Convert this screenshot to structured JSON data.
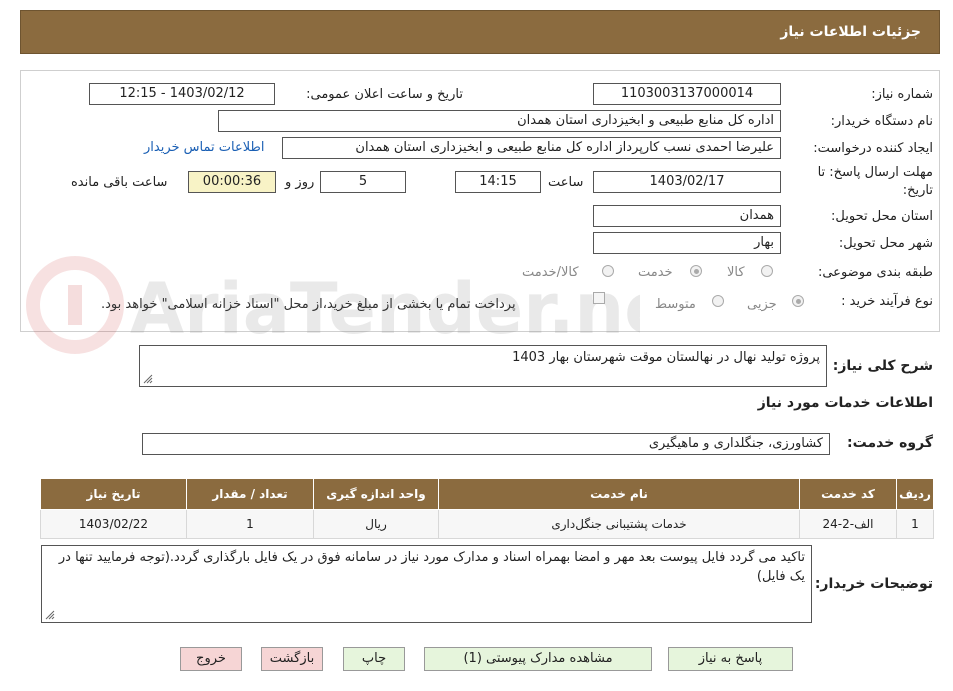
{
  "header": {
    "title": "جزئیات اطلاعات نیاز"
  },
  "form": {
    "need_number_label": "شماره نیاز:",
    "need_number": "1103003137000014",
    "announce_label": "تاریخ و ساعت اعلان عمومی:",
    "announce_value": "1403/02/12 - 12:15",
    "buyer_org_label": "نام دستگاه خریدار:",
    "buyer_org": "اداره کل منابع طبیعی و ابخیزداری استان همدان",
    "requester_label": "ایجاد کننده درخواست:",
    "requester": "علیرضا احمدی نسب کارپرداز اداره کل منابع طبیعی و ابخیزداری استان همدان",
    "contact_link": "اطلاعات تماس خریدار",
    "deadline_label_1": "مهلت ارسال پاسخ: تا",
    "deadline_label_2": "تاریخ:",
    "deadline_date": "1403/02/17",
    "time_label": "ساعت",
    "deadline_time": "14:15",
    "days_value": "5",
    "days_label": "روز و",
    "remaining_time": "00:00:36",
    "remaining_label": "ساعت باقی مانده",
    "province_label": "استان محل تحویل:",
    "province": "همدان",
    "city_label": "شهر محل تحویل:",
    "city": "بهار",
    "category_label": "طبقه بندی موضوعی:",
    "category_options": [
      "کالا",
      "خدمت",
      "کالا/خدمت"
    ],
    "category_selected": "خدمت",
    "process_label": "نوع فرآیند خرید :",
    "process_options": [
      "جزیی",
      "متوسط"
    ],
    "process_selected": "جزیی",
    "payment_note": "پرداخت تمام یا بخشی از مبلغ خرید،از محل \"اسناد خزانه اسلامی\" خواهد بود."
  },
  "description": {
    "label": "شرح کلی نیاز:",
    "text": "پروژه تولید نهال در نهالستان موقت شهرستان بهار 1403"
  },
  "services_section": {
    "title": "اطلاعات خدمات مورد نیاز",
    "group_label": "گروه خدمت:",
    "group_value": "کشاورزی، جنگلداری و ماهیگیری"
  },
  "table": {
    "headers": [
      "ردیف",
      "کد خدمت",
      "نام خدمت",
      "واحد اندازه گیری",
      "تعداد / مقدار",
      "تاریخ نیاز"
    ],
    "rows": [
      [
        "1",
        "الف-2-24",
        "خدمات پشتیبانی جنگل‌داری",
        "ریال",
        "1",
        "1403/02/22"
      ]
    ]
  },
  "buyer_notes": {
    "label": "توضیحات خریدار:",
    "text": "تاکید می گردد فایل پیوست بعد مهر و امضا بهمراه اسناد و مدارک مورد نیاز در سامانه فوق در یک فایل بارگذاری گردد.(توجه فرمایید تنها در یک فایل)"
  },
  "buttons": {
    "respond": "پاسخ به نیاز",
    "attachments": "مشاهده مدارک پیوستی (1)",
    "print": "چاپ",
    "back": "بازگشت",
    "exit": "خروج"
  },
  "watermark": {
    "text": "AriaTender.neT"
  },
  "colors": {
    "header_bg": "#8b6b3f",
    "button_green": "#e6f5dc",
    "button_red": "#f6d5d5",
    "timer_bg": "#f8f3c6",
    "link": "#1a5fb4"
  }
}
